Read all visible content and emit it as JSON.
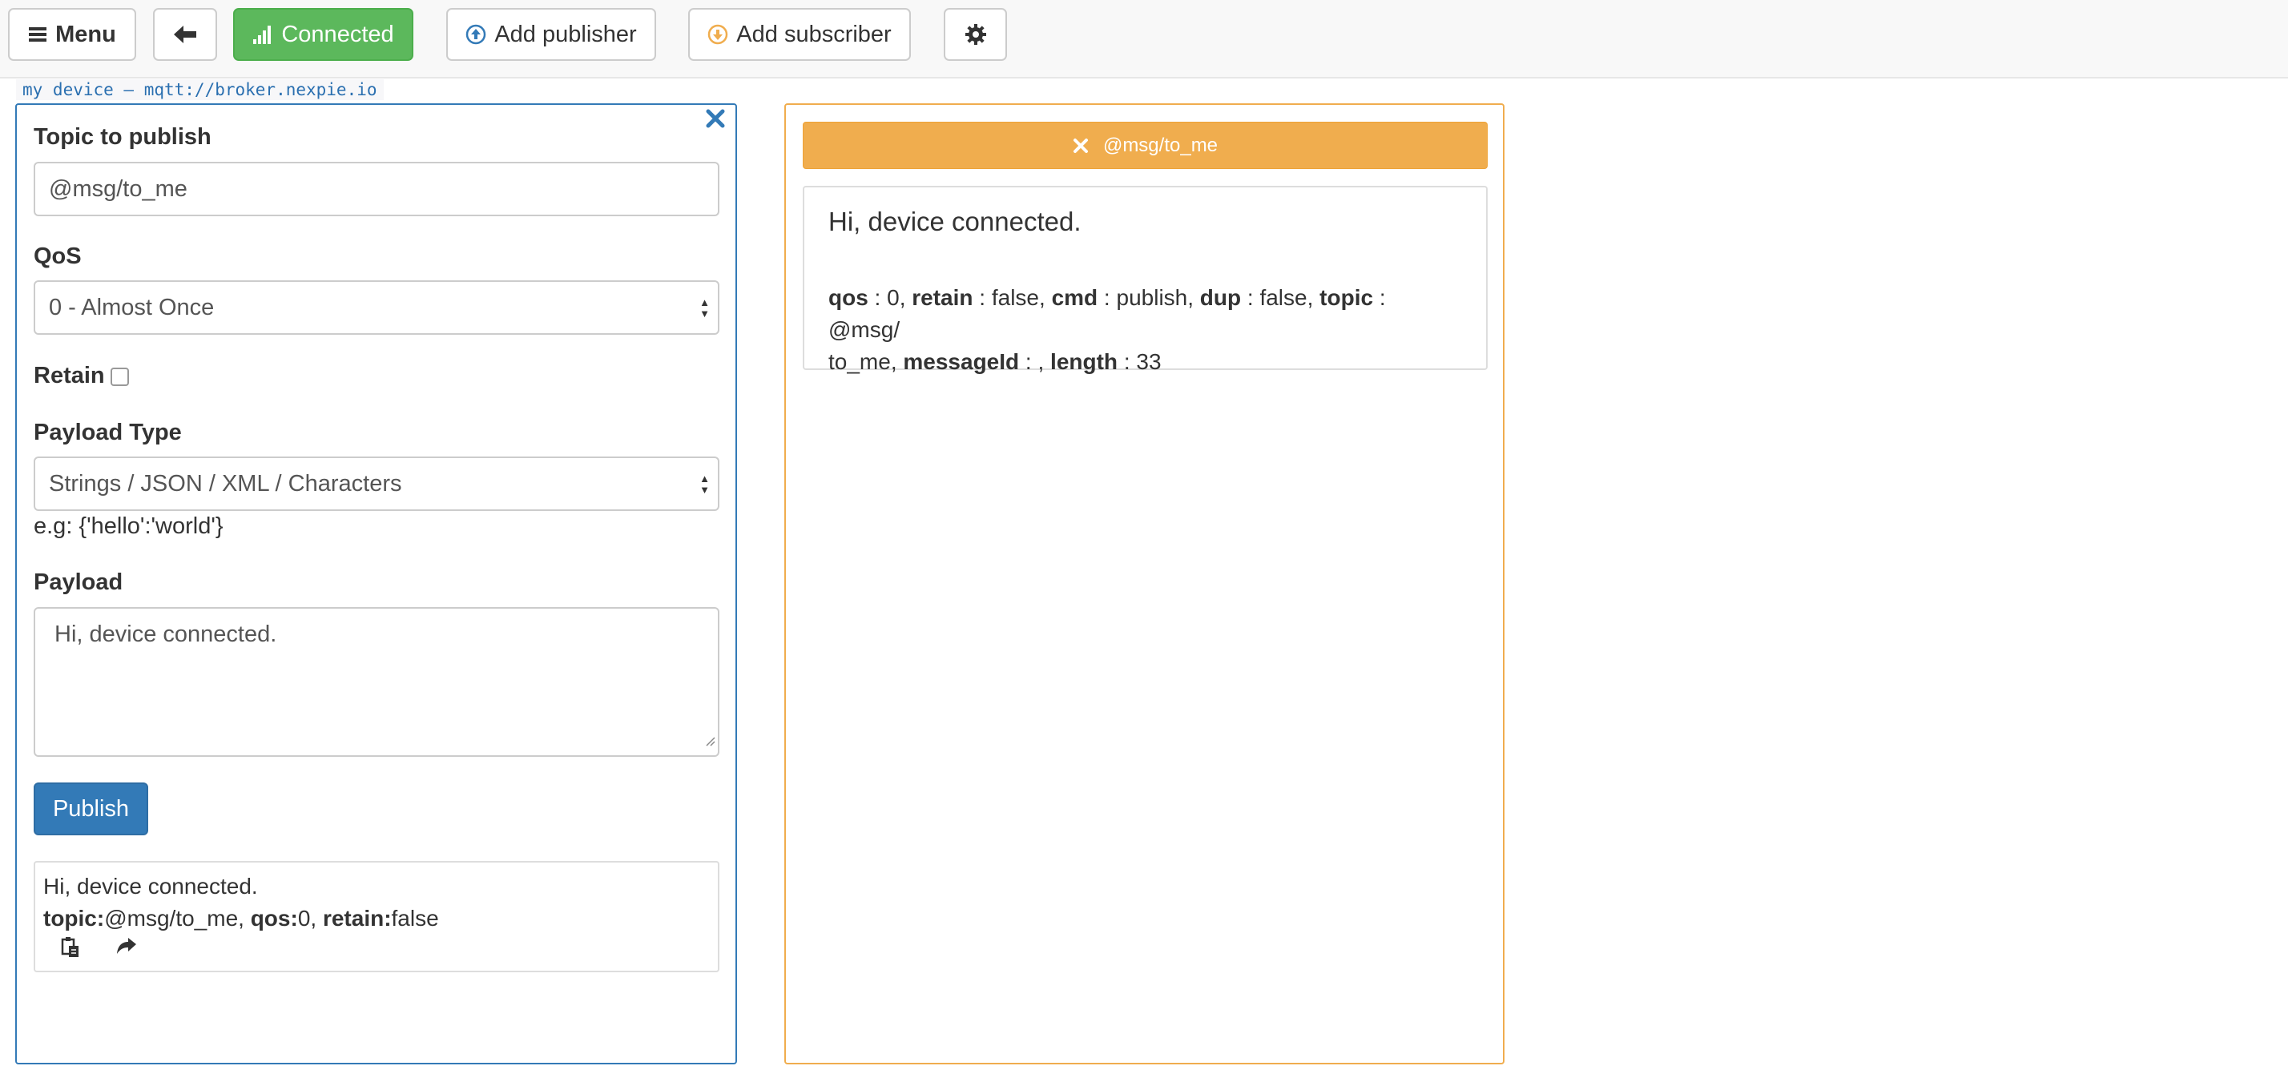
{
  "navbar": {
    "menu_label": "Menu",
    "connected_label": "Connected",
    "add_publisher_label": "Add publisher",
    "add_subscriber_label": "Add subscriber"
  },
  "device_label": "my device – mqtt://broker.nexpie.io",
  "publisher": {
    "topic_label": "Topic to publish",
    "topic_value": "@msg/to_me",
    "qos_label": "QoS",
    "qos_value": "0 - Almost Once",
    "retain_label": "Retain",
    "payload_type_label": "Payload Type",
    "payload_type_value": "Strings / JSON / XML / Characters",
    "payload_hint": "e.g: {'hello':'world'}",
    "payload_label": "Payload",
    "payload_value": "Hi, device connected.",
    "publish_button": "Publish",
    "log": {
      "message": "Hi, device connected.",
      "topic_key": "topic:",
      "topic_value": "@msg/to_me",
      "qos_key": "qos:",
      "qos_value": "0",
      "retain_key": "retain:",
      "retain_value": "false"
    }
  },
  "subscriber": {
    "topic": "@msg/to_me",
    "message": {
      "payload": "Hi, device connected.",
      "qos_key": "qos",
      "qos_value": "0",
      "retain_key": "retain",
      "retain_value": "false",
      "cmd_key": "cmd",
      "cmd_value": "publish",
      "dup_key": "dup",
      "dup_value": "false",
      "topic_key": "topic",
      "topic_value": "@msg/to_me",
      "messageid_key": "messageId",
      "messageid_value": "",
      "length_key": "length",
      "length_value": "33"
    }
  },
  "icons": {
    "menu": "hamburger-icon",
    "back": "arrow-left-icon",
    "connected": "signal-bars-icon",
    "add_publisher": "upload-circle-icon",
    "add_subscriber": "download-circle-icon",
    "settings": "gear-icon",
    "close": "close-icon",
    "copy": "clipboard-icon",
    "share": "share-arrow-icon"
  },
  "colors": {
    "primary": "#337ab7",
    "success": "#5cb85c",
    "warning": "#f0ad4e",
    "add_publisher_icon": "#337ab7",
    "add_subscriber_icon": "#f0ad4e"
  }
}
